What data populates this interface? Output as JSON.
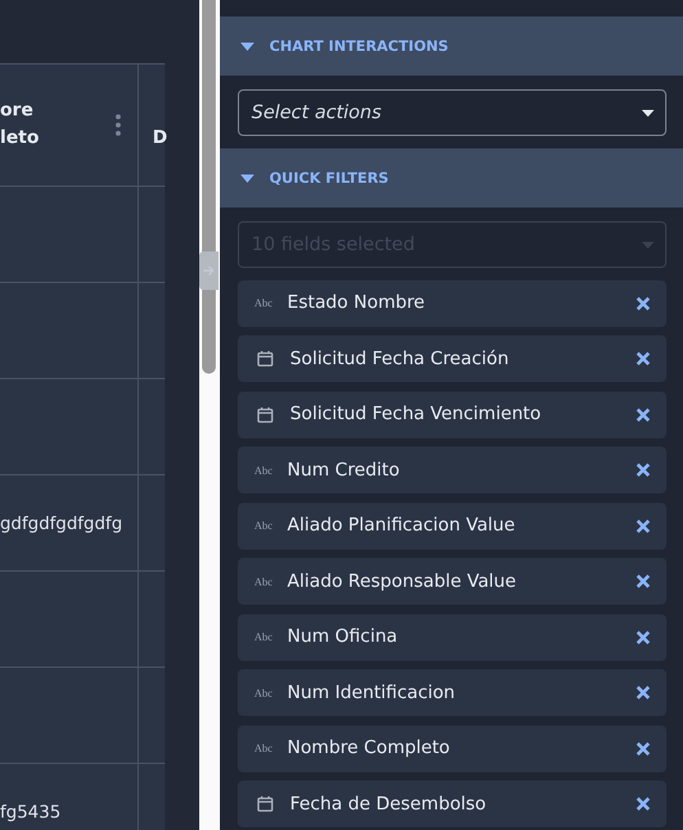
{
  "table": {
    "columns": [
      {
        "label": "ore\nleto",
        "menu": true
      },
      {
        "label": "D",
        "menu": false
      }
    ],
    "rows": [
      [
        "",
        ""
      ],
      [
        "",
        ""
      ],
      [
        "",
        ""
      ],
      [
        "gdfgdfgdfgdfg",
        ""
      ],
      [
        "",
        ""
      ],
      [
        "",
        ""
      ],
      [
        "fg5435",
        ""
      ]
    ]
  },
  "panel": {
    "sections": [
      {
        "title": "CHART INTERACTIONS",
        "expanded": true,
        "select": {
          "placeholder": "Select actions",
          "disabled": false
        }
      },
      {
        "title": "QUICK FILTERS",
        "expanded": true,
        "select": {
          "placeholder": "10 fields selected",
          "disabled": true
        },
        "fields": [
          {
            "kind": "text",
            "type_label": "Abc",
            "label": "Estado Nombre"
          },
          {
            "kind": "date",
            "label": "Solicitud Fecha Creación"
          },
          {
            "kind": "date",
            "label": "Solicitud Fecha Vencimiento"
          },
          {
            "kind": "text",
            "type_label": "Abc",
            "label": "Num Credito"
          },
          {
            "kind": "text",
            "type_label": "Abc",
            "label": "Aliado Planificacion Value"
          },
          {
            "kind": "text",
            "type_label": "Abc",
            "label": "Aliado Responsable Value"
          },
          {
            "kind": "text",
            "type_label": "Abc",
            "label": "Num Oficina"
          },
          {
            "kind": "text",
            "type_label": "Abc",
            "label": "Num Identificacion"
          },
          {
            "kind": "text",
            "type_label": "Abc",
            "label": "Nombre Completo"
          },
          {
            "kind": "date",
            "label": "Fecha de Desembolso"
          }
        ]
      }
    ]
  }
}
